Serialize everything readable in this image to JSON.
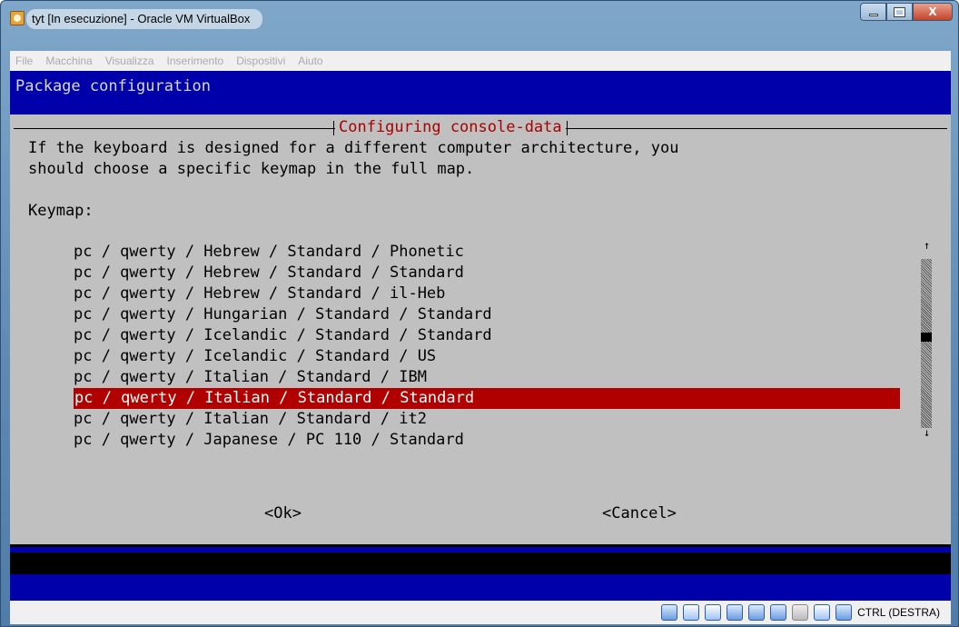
{
  "window": {
    "title": "tyt [In esecuzione] - Oracle VM VirtualBox",
    "buttons": [
      "minimize",
      "maximize",
      "close"
    ]
  },
  "menubar": {
    "items": [
      "File",
      "Macchina",
      "Visualizza",
      "Inserimento",
      "Dispositivi",
      "Aiuto"
    ]
  },
  "screen": {
    "header": "Package configuration",
    "dialog": {
      "title": "Configuring console-data",
      "description_line1": "If the keyboard is designed for a different computer architecture, you",
      "description_line2": "should choose a specific keymap in the full map.",
      "keymap_label": "Keymap:",
      "keymaps": [
        "pc / qwerty / Hebrew / Standard / Phonetic",
        "pc / qwerty / Hebrew / Standard / Standard",
        "pc / qwerty / Hebrew / Standard / il-Heb",
        "pc / qwerty / Hungarian / Standard / Standard",
        "pc / qwerty / Icelandic / Standard / Standard",
        "pc / qwerty / Icelandic / Standard / US",
        "pc / qwerty / Italian / Standard / IBM",
        "pc / qwerty / Italian / Standard / Standard",
        "pc / qwerty / Italian / Standard / it2",
        "pc / qwerty / Japanese / PC 110 / Standard"
      ],
      "selected_index": 7,
      "scroll_up": "↑",
      "scroll_down": "↓",
      "ok_label": "<Ok>",
      "cancel_label": "<Cancel>"
    }
  },
  "statusbar": {
    "icons": [
      "hard-disk-icon",
      "network-icon",
      "usb-icon",
      "shared-folder-icon",
      "display-icon",
      "network-adapter-icon",
      "virtualization-icon",
      "mouse-integration-icon",
      "arrow-down-icon"
    ],
    "host_key": "CTRL (DESTRA)"
  },
  "colors": {
    "terminal_bg": "#0000aa",
    "dialog_bg": "#c0c0c0",
    "selection": "#b00000",
    "dialog_title": "#aa0000"
  }
}
